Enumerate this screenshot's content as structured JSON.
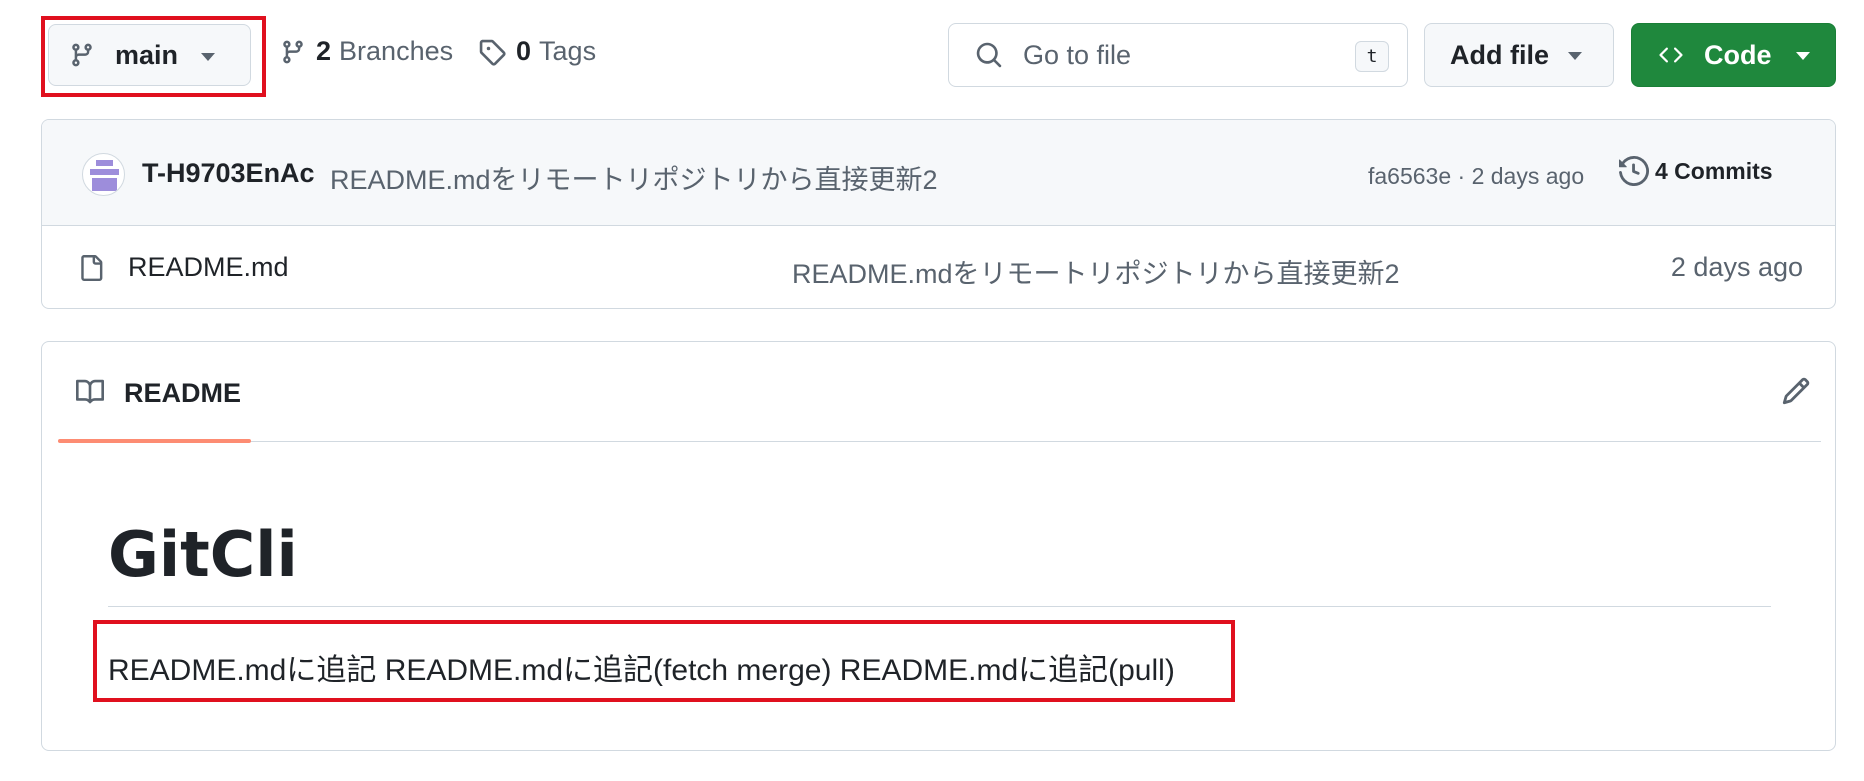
{
  "toolbar": {
    "branch_label": "main",
    "branches_count": "2",
    "branches_label": "Branches",
    "tags_count": "0",
    "tags_label": "Tags",
    "search_placeholder": "Go to file",
    "search_shortcut": "t",
    "add_file_label": "Add file",
    "code_label": "Code"
  },
  "latest_commit": {
    "author": "T-H9703EnAc",
    "message": "README.mdをリモートリポジトリから直接更新2",
    "sha_age": "fa6563e · 2 days ago",
    "commits_label": "4 Commits"
  },
  "files": [
    {
      "name": "README.md",
      "message": "README.mdをリモートリポジトリから直接更新2",
      "age": "2 days ago"
    }
  ],
  "readme": {
    "tab_label": "README",
    "title": "GitCli",
    "line": "README.mdに追記 README.mdに追記(fetch merge) README.mdに追記(pull)"
  },
  "colors": {
    "primary_button": "#1f883d",
    "tab_underline": "#fd8c73",
    "annotation_box": "#e0101e"
  }
}
